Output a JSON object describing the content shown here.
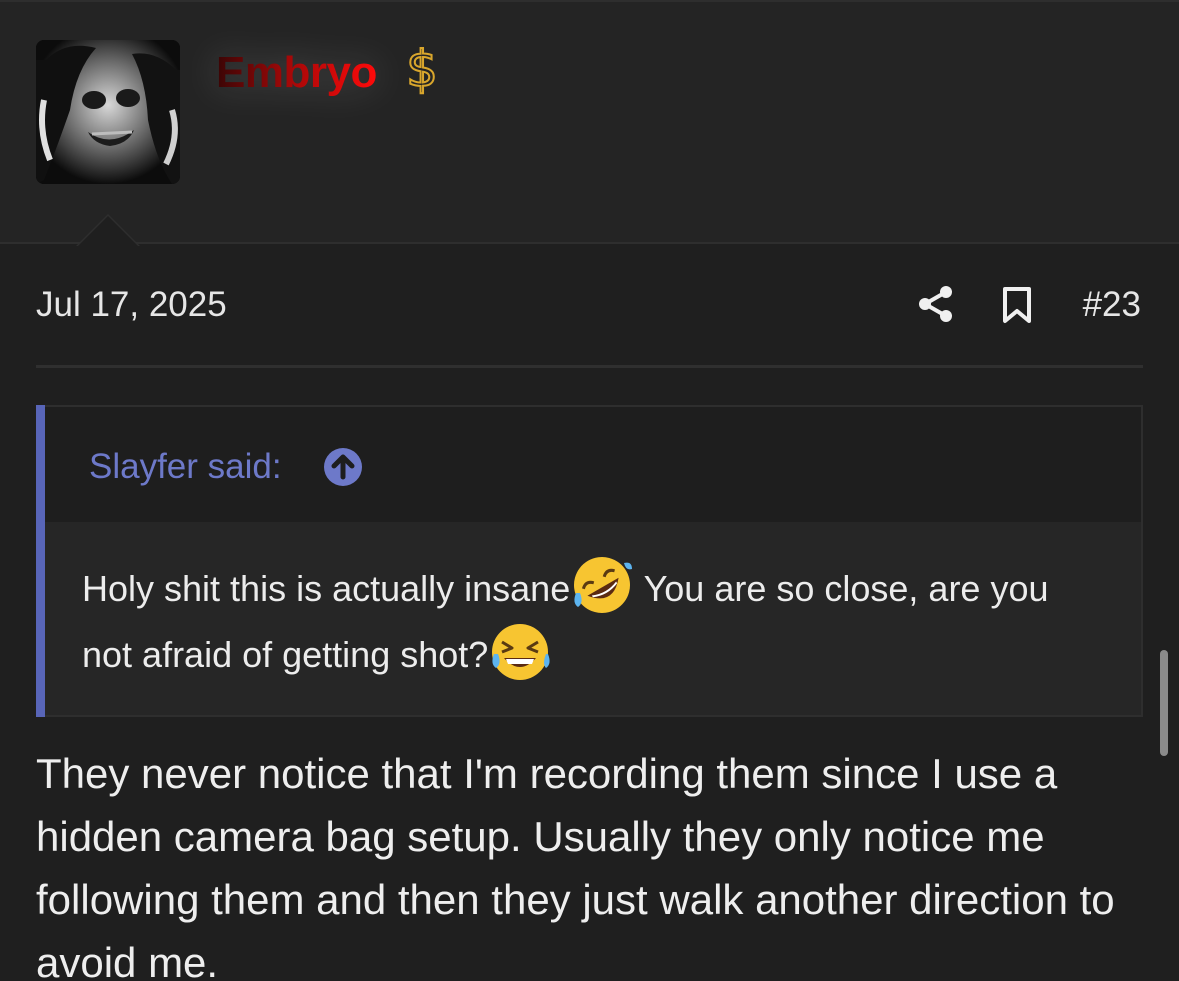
{
  "user": {
    "name": "Embryo",
    "badge_icon": "dollar-icon",
    "name_gradient": [
      "#3a0505",
      "#ff0a0a"
    ]
  },
  "post": {
    "date": "Jul 17, 2025",
    "number": "#23",
    "actions": [
      "share-icon",
      "bookmark-icon"
    ]
  },
  "quote": {
    "author_label": "Slayfer said:",
    "jump_icon": "up-arrow-icon",
    "text_part1": "Holy shit this is actually insane",
    "emoji1": "rolling-on-floor-laughing-emoji",
    "text_part2": " You are so close, are you not afraid of getting shot?",
    "emoji2": "grinning-squinting-sweat-emoji",
    "accent_color": "#5865b8"
  },
  "reply": {
    "text": "They never notice that I'm recording them since I use a hidden camera bag setup. Usually they only notice me following them and then they just walk another direction to avoid me."
  }
}
